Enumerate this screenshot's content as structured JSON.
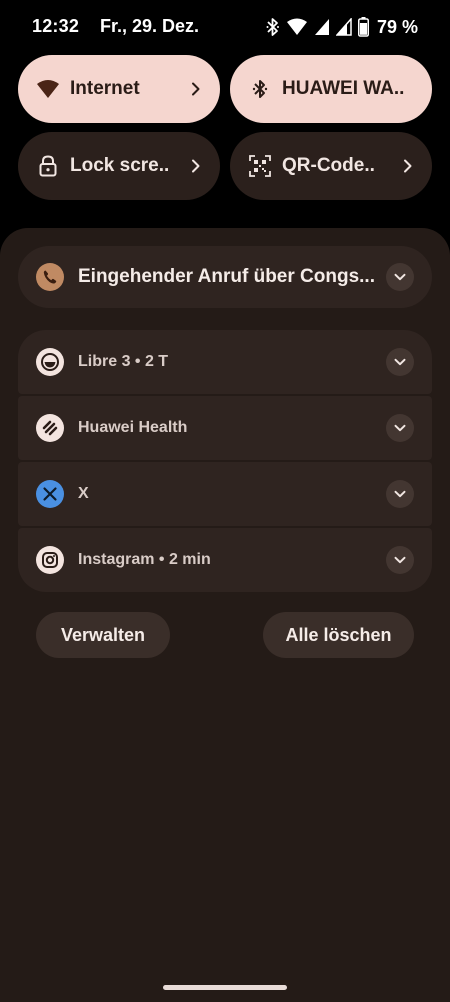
{
  "status_bar": {
    "time": "12:32",
    "date": "Fr., 29. Dez.",
    "battery": "79 %",
    "icons": [
      "bluetooth-icon",
      "wifi-icon",
      "signal-icon",
      "signal-icon",
      "battery-icon"
    ]
  },
  "quick_settings": {
    "tiles": [
      {
        "label": "Internet",
        "icon": "wifi-icon",
        "active": true,
        "has_chevron": true
      },
      {
        "label": "HUAWEI WA..",
        "icon": "bluetooth-icon",
        "active": true,
        "has_chevron": false
      },
      {
        "label": "Lock scre..",
        "icon": "lock-icon",
        "active": false,
        "has_chevron": true
      },
      {
        "label": "QR-Code..",
        "icon": "qr-code-icon",
        "active": false,
        "has_chevron": true
      }
    ]
  },
  "notifications": {
    "call": {
      "text": "Eingehender Anruf über Congs...",
      "icon": "phone-icon"
    },
    "items": [
      {
        "text": "Libre 3 • 2 T",
        "icon": "libre-icon"
      },
      {
        "text": "Huawei Health",
        "icon": "huawei-health-icon"
      },
      {
        "text": "X",
        "icon": "x-logo-icon"
      },
      {
        "text": "Instagram • 2 min",
        "icon": "instagram-icon"
      }
    ]
  },
  "actions": {
    "manage": "Verwalten",
    "clear_all": "Alle löschen"
  },
  "colors": {
    "tile_active": "#f5d6cf",
    "tile_inactive": "#2b201c",
    "shade_background": "#241b17",
    "card_background": "#2f2420",
    "call_icon_bg": "#c08a63",
    "x_icon_bg": "#4a90e2"
  }
}
